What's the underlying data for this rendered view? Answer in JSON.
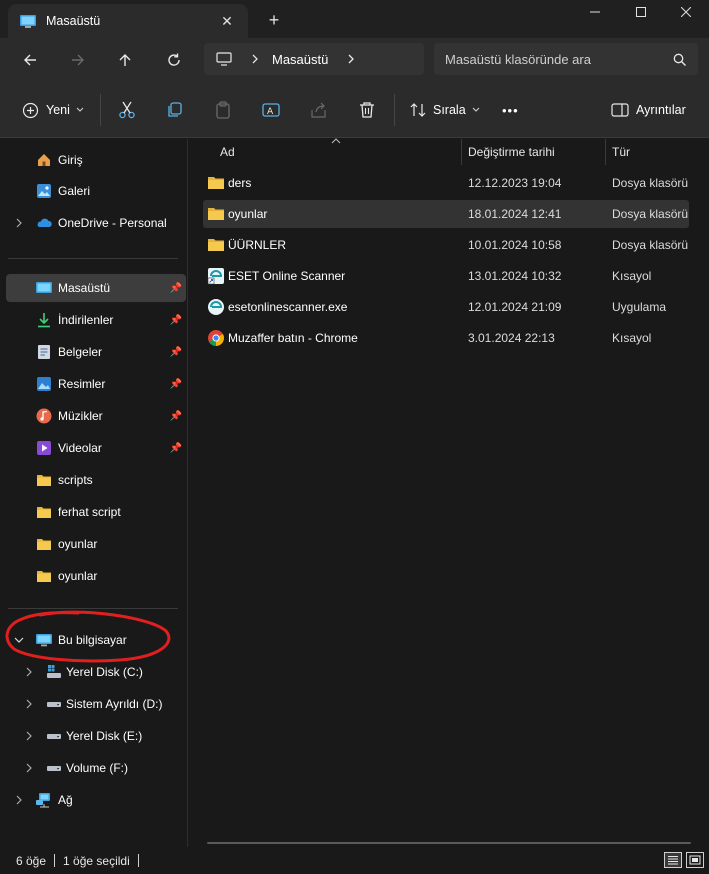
{
  "window": {
    "tab_title": "Masaüstü",
    "close_tab": "✕",
    "new_tab": "+",
    "minimize": "—",
    "maximize": "☐",
    "close": "✕"
  },
  "address": {
    "crumb": "Masaüstü",
    "search_placeholder": "Masaüstü klasöründe ara"
  },
  "toolbar": {
    "new_label": "Yeni",
    "sort_label": "Sırala",
    "more_label": "•••",
    "details_label": "Ayrıntılar"
  },
  "sidebar": {
    "top_items": [
      {
        "label": "Giriş",
        "icon": "home-icon"
      },
      {
        "label": "Galeri",
        "icon": "gallery-icon"
      },
      {
        "label": "OneDrive - Personal",
        "icon": "onedrive-icon"
      }
    ],
    "quick_items": [
      {
        "label": "Masaüstü",
        "icon": "desktop-icon",
        "pinned": true
      },
      {
        "label": "İndirilenler",
        "icon": "download-icon",
        "pinned": true
      },
      {
        "label": "Belgeler",
        "icon": "documents-icon",
        "pinned": true
      },
      {
        "label": "Resimler",
        "icon": "pictures-icon",
        "pinned": true
      },
      {
        "label": "Müzikler",
        "icon": "music-icon",
        "pinned": true
      },
      {
        "label": "Videolar",
        "icon": "videos-icon",
        "pinned": true
      },
      {
        "label": "scripts",
        "icon": "folder-icon",
        "pinned": false
      },
      {
        "label": "ferhat script",
        "icon": "folder-icon",
        "pinned": false
      },
      {
        "label": "oyunlar",
        "icon": "folder-icon",
        "pinned": false
      },
      {
        "label": "oyunlar",
        "icon": "folder-icon",
        "pinned": false
      }
    ],
    "this_pc": "Bu bilgisayar",
    "drives": [
      {
        "label": "Yerel Disk (C:)",
        "icon": "system-drive-icon"
      },
      {
        "label": "Sistem Ayrıldı (D:)",
        "icon": "drive-icon"
      },
      {
        "label": "Yerel Disk (E:)",
        "icon": "drive-icon"
      },
      {
        "label": "Volume (F:)",
        "icon": "drive-icon"
      }
    ],
    "network": "Ağ"
  },
  "columns": {
    "name": "Ad",
    "date": "Değiştirme tarihi",
    "type": "Tür"
  },
  "files": [
    {
      "name": "ders",
      "date": "12.12.2023 19:04",
      "type": "Dosya klasörü",
      "icon": "folder-icon"
    },
    {
      "name": "oyunlar",
      "date": "18.01.2024 12:41",
      "type": "Dosya klasörü",
      "icon": "folder-icon"
    },
    {
      "name": "ÜÜRNLER",
      "date": "10.01.2024 10:58",
      "type": "Dosya klasörü",
      "icon": "folder-icon"
    },
    {
      "name": "ESET Online Scanner",
      "date": "13.01.2024 10:32",
      "type": "Kısayol",
      "icon": "eset-shortcut-icon"
    },
    {
      "name": "esetonlinescanner.exe",
      "date": "12.01.2024 21:09",
      "type": "Uygulama",
      "icon": "eset-app-icon"
    },
    {
      "name": "Muzaffer batın - Chrome",
      "date": "3.01.2024 22:13",
      "type": "Kısayol",
      "icon": "chrome-icon"
    }
  ],
  "status": {
    "item_count": "6 öğe",
    "selected_count": "1 öğe seçildi"
  },
  "colors": {
    "background": "#191919",
    "chrome": "#2b2b2b",
    "folder": "#f4c042",
    "annotation": "#e0201f",
    "accent": "#4cc2ff"
  }
}
